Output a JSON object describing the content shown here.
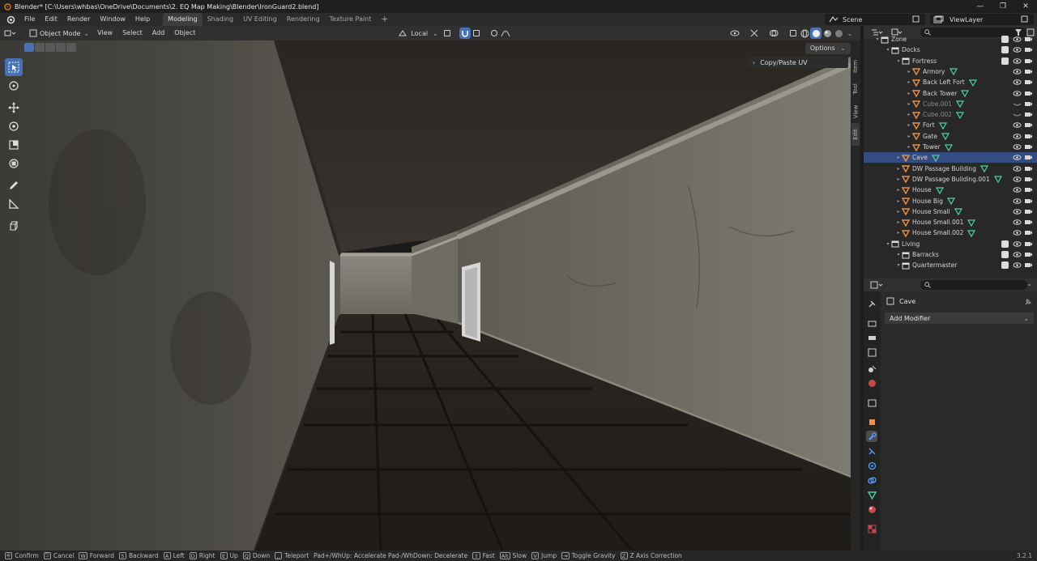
{
  "window": {
    "title": "Blender* [C:\\Users\\whbas\\OneDrive\\Documents\\2. EQ Map Making\\Blender\\IronGuard2.blend]",
    "controls": [
      "—",
      "❐",
      "✕"
    ]
  },
  "menubar": {
    "menus": [
      "File",
      "Edit",
      "Render",
      "Window",
      "Help"
    ],
    "workspaces": [
      {
        "label": "Modeling",
        "active": true
      },
      {
        "label": "Shading",
        "active": false
      },
      {
        "label": "UV Editing",
        "active": false
      },
      {
        "label": "Rendering",
        "active": false
      },
      {
        "label": "Texture Paint",
        "active": false
      }
    ],
    "add_workspace": "+",
    "scene": "Scene",
    "view_layer": "ViewLayer"
  },
  "viewport_header": {
    "mode": "Object Mode",
    "menus": [
      "View",
      "Select",
      "Add",
      "Object"
    ],
    "orientation": "Local"
  },
  "viewport": {
    "options_label": "Options",
    "panel_title": "Copy/Paste UV",
    "side_tabs": [
      "Item",
      "Tool",
      "View",
      "Edit"
    ]
  },
  "outliner": {
    "rows": [
      {
        "label": "Zone",
        "depth": 2,
        "kind": "collection",
        "dim": false
      },
      {
        "label": "Docks",
        "depth": 3,
        "kind": "collection",
        "dim": false
      },
      {
        "label": "Fortress",
        "depth": 4,
        "kind": "collection",
        "dim": false
      },
      {
        "label": "Armory",
        "depth": 5,
        "kind": "mesh",
        "dim": false
      },
      {
        "label": "Back Left Fort",
        "depth": 5,
        "kind": "mesh",
        "dim": false
      },
      {
        "label": "Back Tower",
        "depth": 5,
        "kind": "mesh",
        "dim": false
      },
      {
        "label": "Cube.001",
        "depth": 5,
        "kind": "mesh",
        "dim": true
      },
      {
        "label": "Cube.002",
        "depth": 5,
        "kind": "mesh",
        "dim": true
      },
      {
        "label": "Fort",
        "depth": 5,
        "kind": "mesh",
        "dim": false
      },
      {
        "label": "Gate",
        "depth": 5,
        "kind": "mesh",
        "dim": false
      },
      {
        "label": "Tower",
        "depth": 5,
        "kind": "mesh",
        "dim": false
      },
      {
        "label": "Cave",
        "depth": 4,
        "kind": "mesh",
        "dim": false,
        "selected": true
      },
      {
        "label": "DW Passage Building",
        "depth": 4,
        "kind": "mesh",
        "dim": false
      },
      {
        "label": "DW Passage Building.001",
        "depth": 4,
        "kind": "mesh",
        "dim": false
      },
      {
        "label": "House",
        "depth": 4,
        "kind": "mesh",
        "dim": false
      },
      {
        "label": "House Big",
        "depth": 4,
        "kind": "mesh",
        "dim": false
      },
      {
        "label": "House Small",
        "depth": 4,
        "kind": "mesh",
        "dim": false
      },
      {
        "label": "House Small.001",
        "depth": 4,
        "kind": "mesh",
        "dim": false
      },
      {
        "label": "House Small.002",
        "depth": 4,
        "kind": "mesh",
        "dim": false
      },
      {
        "label": "Living",
        "depth": 3,
        "kind": "collection",
        "dim": false
      },
      {
        "label": "Barracks",
        "depth": 4,
        "kind": "collection",
        "dim": false
      },
      {
        "label": "Quartermaster",
        "depth": 4,
        "kind": "collection",
        "dim": false
      }
    ]
  },
  "properties": {
    "object_name": "Cave",
    "add_modifier": "Add Modifier"
  },
  "statusbar": {
    "items": [
      {
        "key": "⎆",
        "label": "Confirm"
      },
      {
        "key": "⎋",
        "label": "Cancel"
      },
      {
        "key": "W",
        "label": "Forward"
      },
      {
        "key": "S",
        "label": "Backward"
      },
      {
        "key": "A",
        "label": "Left"
      },
      {
        "key": "D",
        "label": "Right"
      },
      {
        "key": "E",
        "label": "Up"
      },
      {
        "key": "Q",
        "label": "Down"
      },
      {
        "key": "␣",
        "label": "Teleport"
      }
    ],
    "wheel_hint": "Pad+/WhUp: Accelerate  Pad-/WhDown: Decelerate",
    "items2": [
      {
        "key": "⇧",
        "label": "Fast"
      },
      {
        "key": "Alt",
        "label": "Slow"
      },
      {
        "key": "V",
        "label": "Jump"
      },
      {
        "key": "⇥",
        "label": "Toggle Gravity"
      },
      {
        "key": "Z",
        "label": "Z Axis Correction"
      }
    ],
    "version": "3.2.1"
  },
  "colors": {
    "accent": "#4772b3",
    "selected_row": "#334d80",
    "mesh_icon": "#e8914b",
    "data_icon": "#4fd1a2"
  }
}
